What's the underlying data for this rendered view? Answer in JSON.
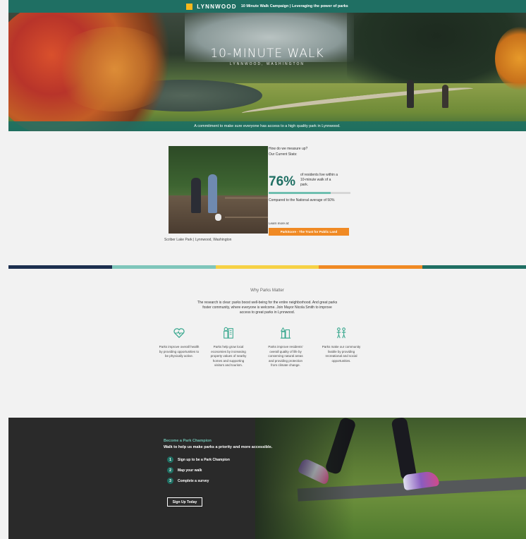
{
  "topbar": {
    "logo_text": "LYNNWOOD",
    "title": "10 Minute Walk Campaign | Leveraging the power of parks"
  },
  "hero": {
    "brand_title": "10-MINUTE WALK",
    "brand_subtitle": "LYNNWOOD, WASHINGTON",
    "tagline": "A commitment to make sure everyone has access to a high quality park in Lynnwood."
  },
  "stats": {
    "photo_caption": "Scriber Lake Park | Lynnwood, Washington",
    "question": "How do we measure up?",
    "question_sub": "Our Current Stats:",
    "percent": "76%",
    "percent_value": 76,
    "description": "of residents live within a 10-minute walk of a park.",
    "comparison": "Compared to the National average of 50%",
    "learn_label": "Learn more at:",
    "learn_button": "ParkScore - The Trust for Public Land"
  },
  "divider_colors": [
    "#1c2f4f",
    "#7fc6bb",
    "#f6d145",
    "#f08a24",
    "#1f6f63"
  ],
  "why": {
    "heading": "Why Parks Matter",
    "intro": "The research is clear: parks boost well-being for the entire neighborhood. And great parks foster community, where everyone is welcome. Join Mayor Nicola Smith to improve access to great parks in Lynnwood.",
    "features": [
      {
        "icon": "heart-pulse-icon",
        "text": "Parks improve overall health by providing opportunities to be physically active."
      },
      {
        "icon": "city-building-icon",
        "text": "Parks help grow local economies by increasing property values of nearby homes and supporting visitors and tourism."
      },
      {
        "icon": "nature-tree-icon",
        "text": "Parks improve residents' overall quality of life by conserving natural areas and providing protection from climate change."
      },
      {
        "icon": "community-people-icon",
        "text": "Parks make our community livable by providing recreational and social opportunities."
      }
    ]
  },
  "champion": {
    "title": "Become a Park Champion",
    "subtitle": "Walk to help us make parks a priority and more accessible.",
    "steps": [
      {
        "num": "1",
        "label": "Sign up to be a Park Champion"
      },
      {
        "num": "2",
        "label": "Map your walk"
      },
      {
        "num": "3",
        "label": "Complete a survey"
      }
    ],
    "button": "Sign Up Today"
  },
  "colors": {
    "brand_teal": "#1f6f63",
    "accent_orange": "#f08a24",
    "light_teal": "#6fbfb0"
  }
}
